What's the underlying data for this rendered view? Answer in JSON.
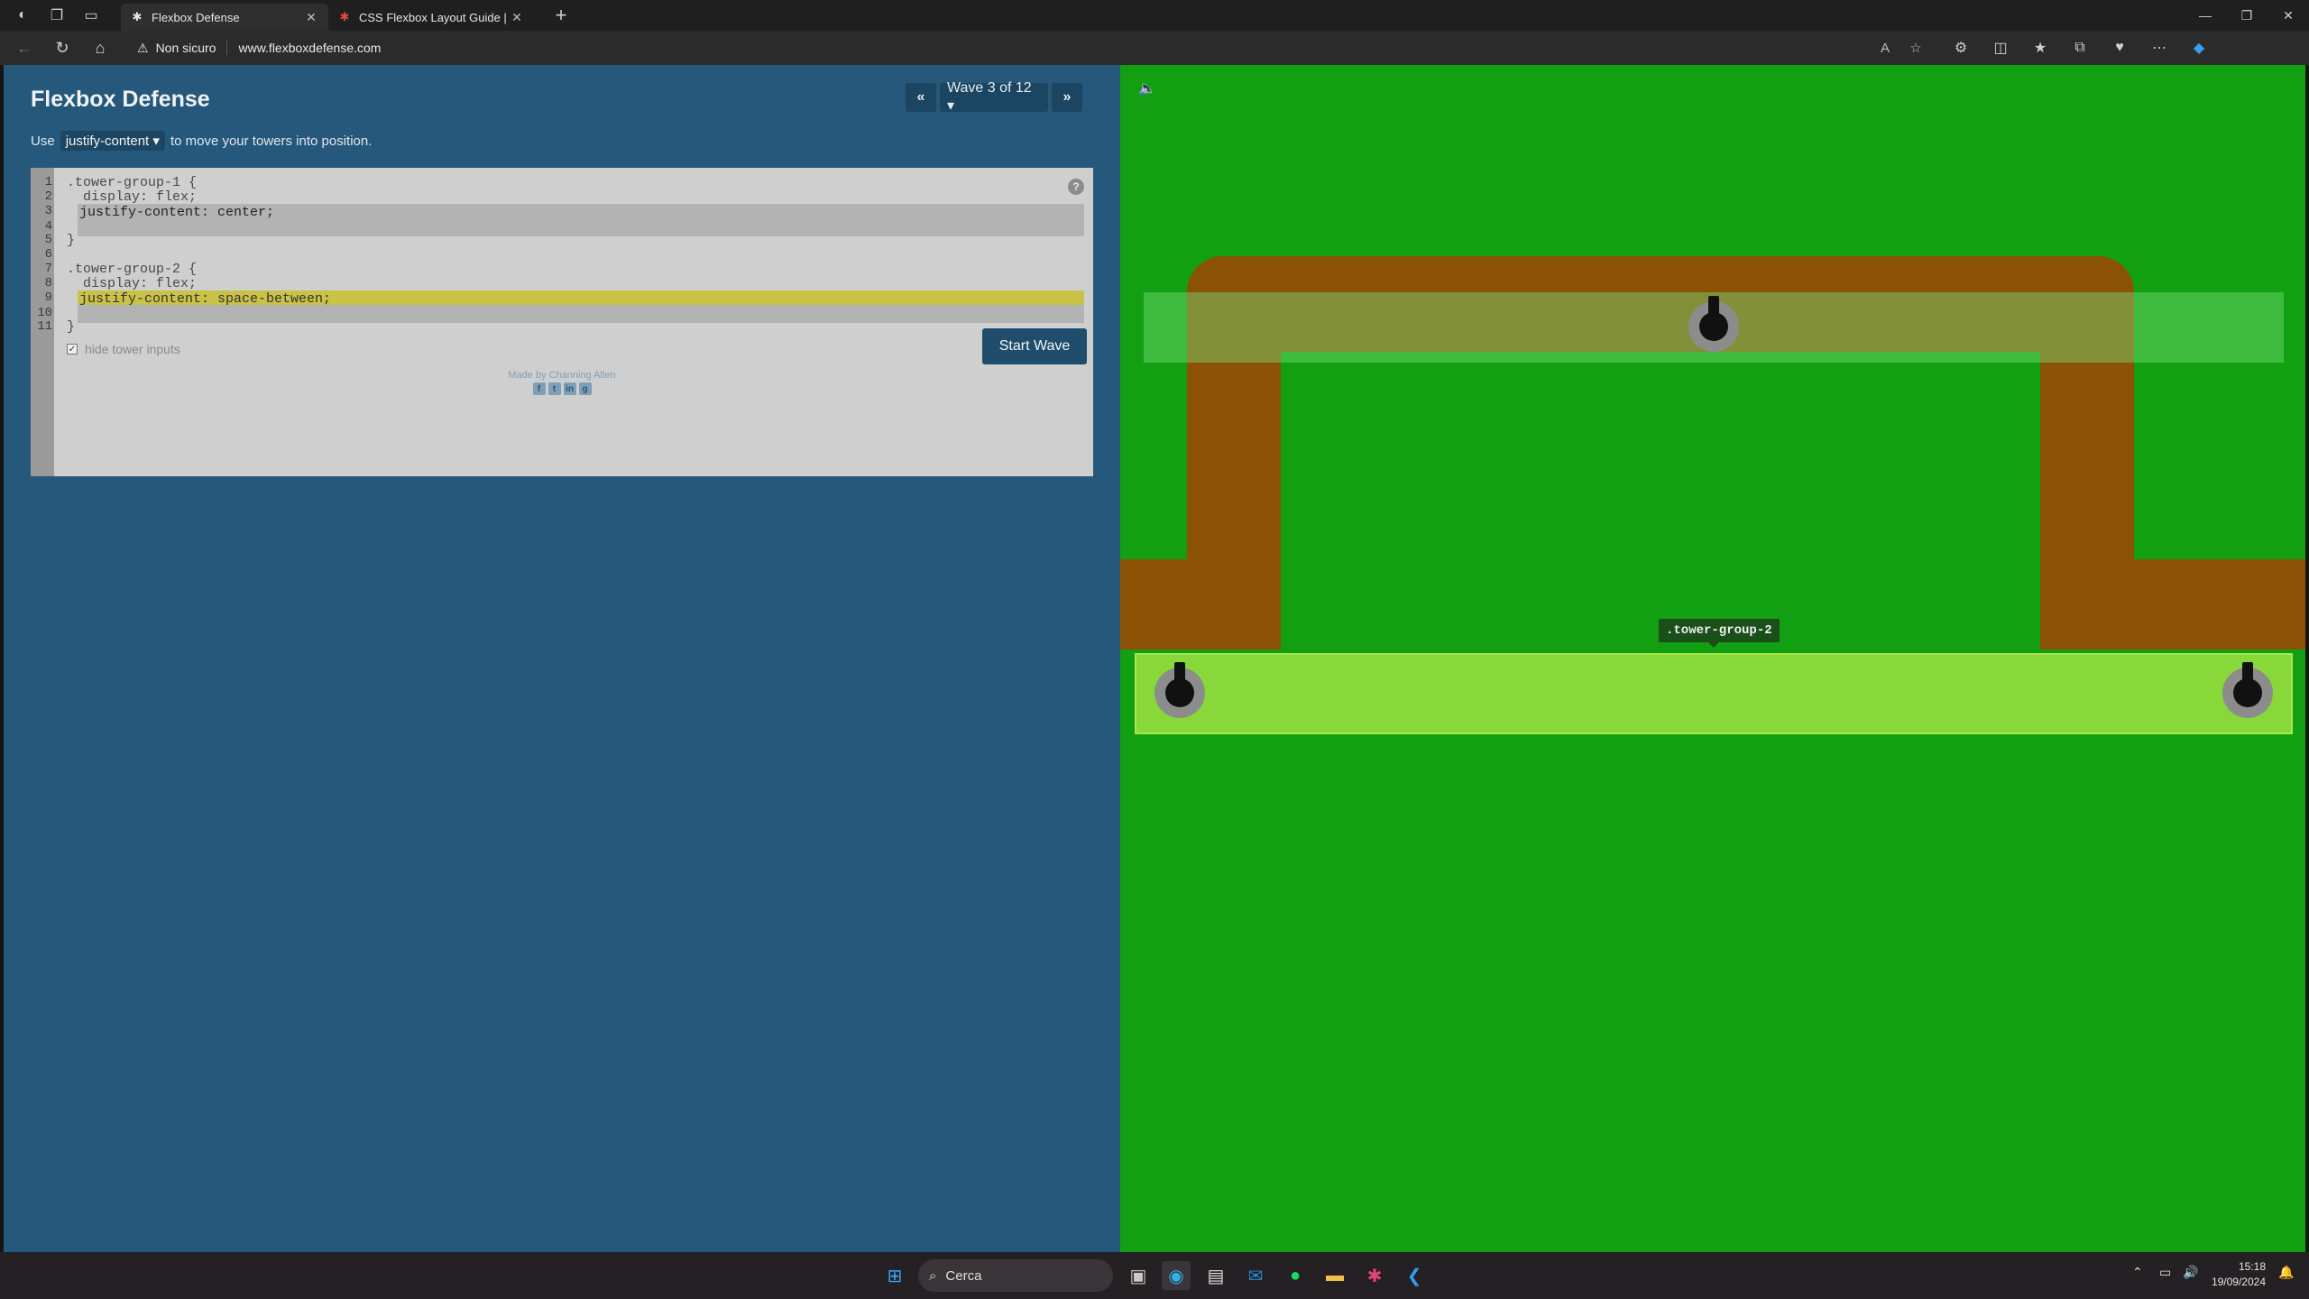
{
  "browser": {
    "tabs": [
      {
        "title": "Flexbox Defense",
        "active": true,
        "favicon": "✱"
      },
      {
        "title": "CSS Flexbox Layout Guide | CSS-T",
        "active": false,
        "favicon": "✱"
      }
    ],
    "address": {
      "security_label": "Non sicuro",
      "url": "www.flexboxdefense.com"
    }
  },
  "app": {
    "title": "Flexbox Defense",
    "instruction": {
      "prefix": "Use",
      "keyword": "justify-content ▾",
      "suffix": "to move your towers into position."
    },
    "wave": {
      "label": "Wave 3 of 12 ▾",
      "prev": "«",
      "next": "»"
    },
    "editor": {
      "line_numbers": [
        "1",
        "2",
        "3",
        "4",
        "5",
        "6",
        "7",
        "8",
        "9",
        "10",
        "11"
      ],
      "lines": {
        "l1": ".tower-group-1 {",
        "l2": "  display: flex;",
        "l5": "}",
        "l7": ".tower-group-2 {",
        "l8": "  display: flex;",
        "l11": "}"
      },
      "inputs": {
        "group1_line1": "justify-content: center;",
        "group1_line2": "",
        "group2_line1": "justify-content: space-between;",
        "group2_line2": ""
      },
      "help": "?",
      "start_button": "Start Wave",
      "hide_inputs_label": "hide tower inputs",
      "hide_inputs_checked": true
    },
    "credit": "Made by Channing Allen",
    "social_icons": [
      "facebook-icon",
      "twitter-icon",
      "linkedin-icon",
      "github-icon"
    ]
  },
  "game": {
    "tooltip": ".tower-group-2",
    "colors": {
      "grass": "#12a012",
      "path": "#8b5206",
      "active_row": "#b0eb48"
    }
  },
  "taskbar": {
    "search_placeholder": "Cerca",
    "time": "15:18",
    "date": "19/09/2024"
  }
}
